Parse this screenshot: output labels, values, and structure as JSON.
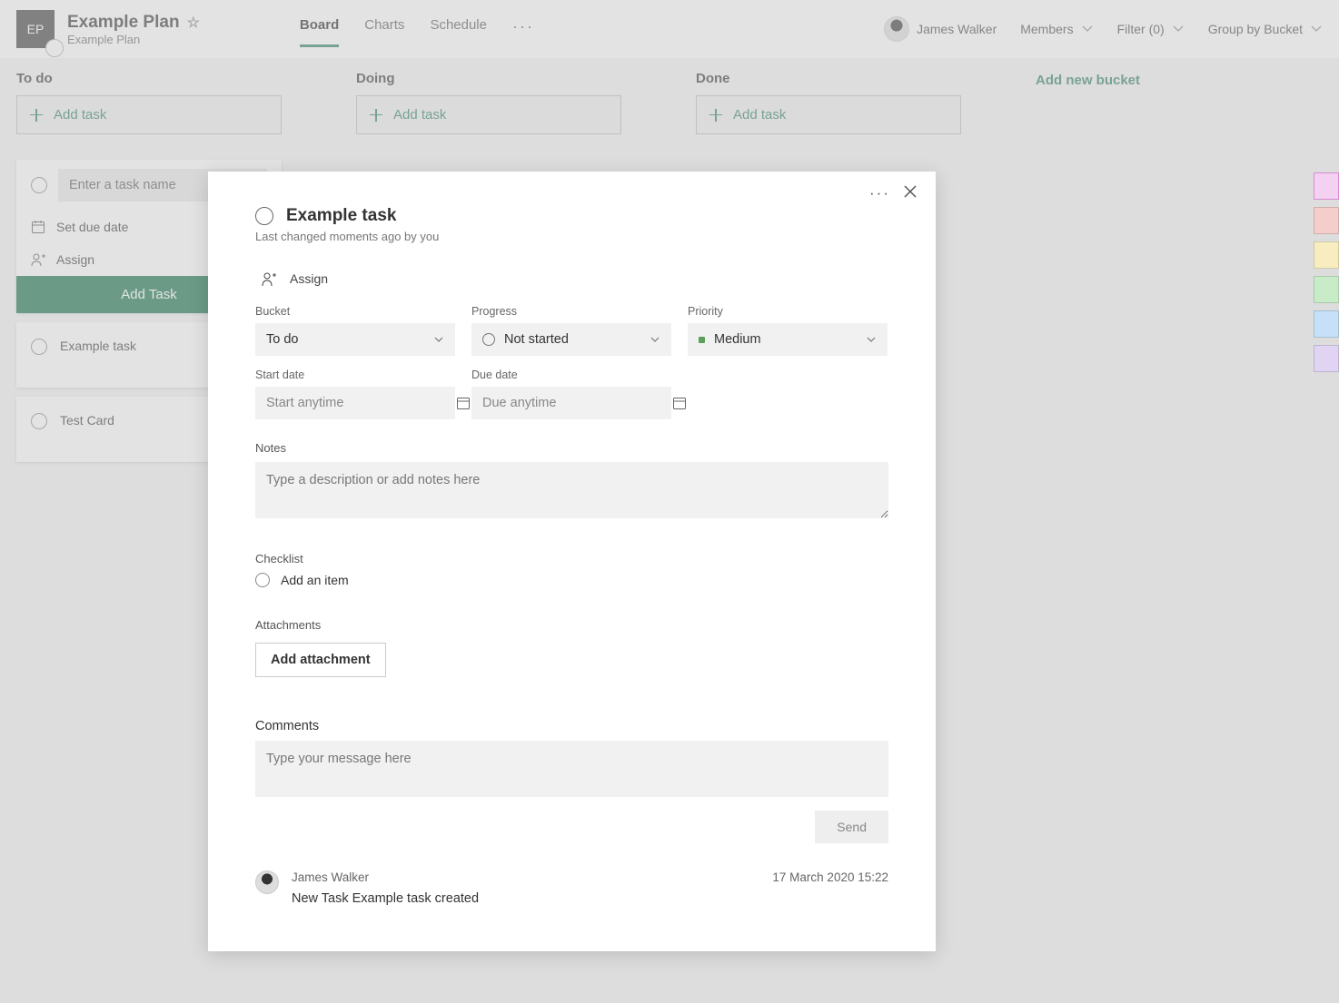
{
  "header": {
    "badge": "EP",
    "title": "Example Plan",
    "subtitle": "Example Plan",
    "tabs": [
      "Board",
      "Charts",
      "Schedule"
    ],
    "active_tab": 0,
    "user_name": "James Walker",
    "members_label": "Members",
    "filter_label": "Filter (0)",
    "group_label": "Group by Bucket"
  },
  "board": {
    "add_task_label": "Add task",
    "add_bucket_label": "Add new bucket",
    "buckets": [
      {
        "title": "To do"
      },
      {
        "title": "Doing"
      },
      {
        "title": "Done"
      }
    ],
    "new_card": {
      "placeholder": "Enter a task name",
      "due_label": "Set due date",
      "assign_label": "Assign",
      "button": "Add Task"
    },
    "cards": [
      "Example task",
      "Test Card"
    ]
  },
  "labels_palette": [
    "#f5d1f1",
    "#f3cecb",
    "#f7edc0",
    "#c8ecc8",
    "#c6e1f7",
    "#e0d4f2"
  ],
  "modal": {
    "title": "Example task",
    "subtitle": "Last changed moments ago by you",
    "assign_label": "Assign",
    "bucket_label": "Bucket",
    "bucket_value": "To do",
    "progress_label": "Progress",
    "progress_value": "Not started",
    "priority_label": "Priority",
    "priority_value": "Medium",
    "start_label": "Start date",
    "start_placeholder": "Start anytime",
    "due_label": "Due date",
    "due_placeholder": "Due anytime",
    "notes_label": "Notes",
    "notes_placeholder": "Type a description or add notes here",
    "checklist_label": "Checklist",
    "checklist_add": "Add an item",
    "attachments_label": "Attachments",
    "attachments_button": "Add attachment",
    "comments_label": "Comments",
    "comments_placeholder": "Type your message here",
    "send_label": "Send",
    "activity": {
      "author": "James Walker",
      "timestamp": "17 March 2020 15:22",
      "text": "New Task Example task created"
    }
  }
}
